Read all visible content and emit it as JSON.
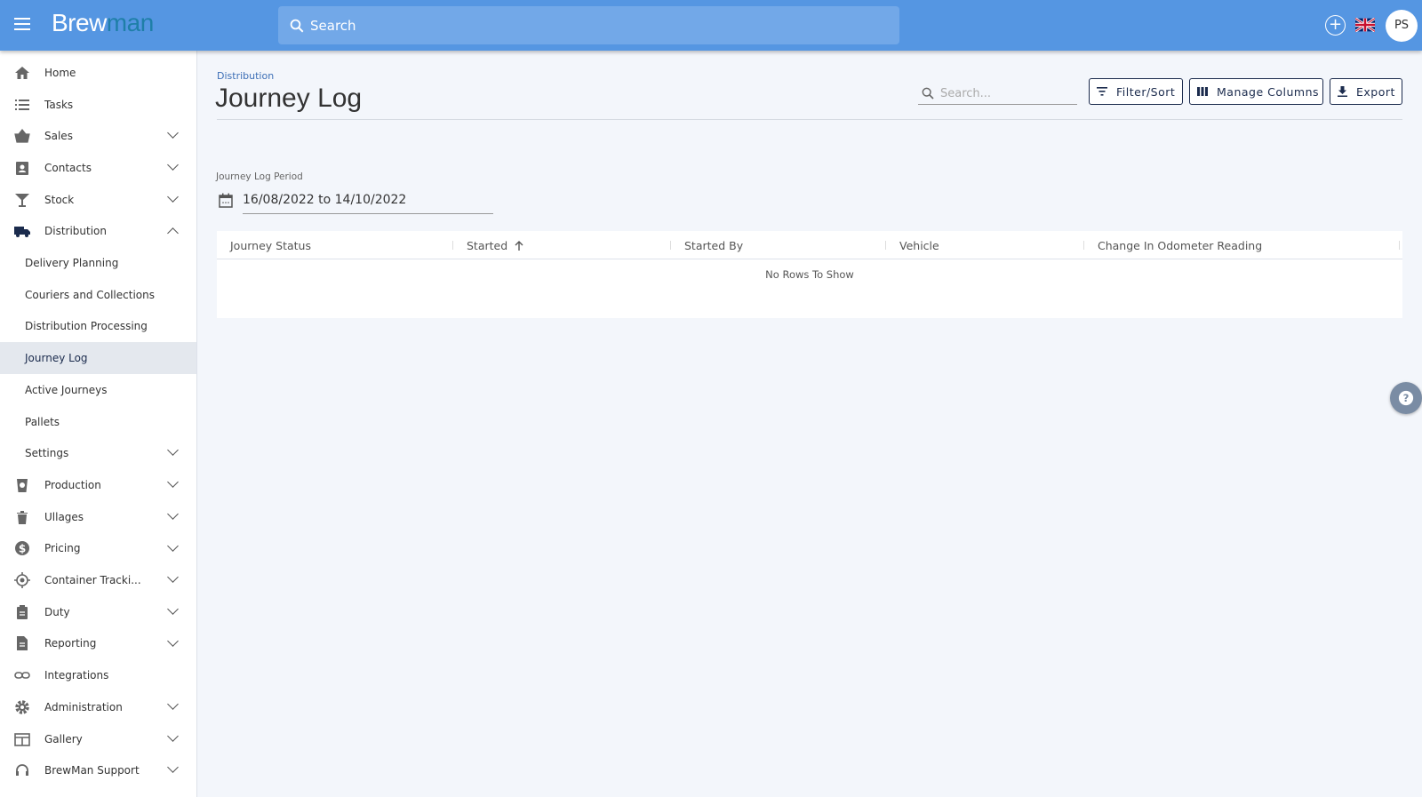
{
  "topbar": {
    "logo_a": "Brew",
    "logo_b": "man",
    "search_placeholder": "Search",
    "avatar_initials": "PS",
    "brand_color": "#5596e2"
  },
  "sidebar": {
    "items": [
      {
        "label": "Home",
        "icon": "home-icon",
        "chevron": "none"
      },
      {
        "label": "Tasks",
        "icon": "list-icon",
        "chevron": "none"
      },
      {
        "label": "Sales",
        "icon": "basket-icon",
        "chevron": "down"
      },
      {
        "label": "Contacts",
        "icon": "contacts-icon",
        "chevron": "down"
      },
      {
        "label": "Stock",
        "icon": "glass-icon",
        "chevron": "down"
      },
      {
        "label": "Distribution",
        "icon": "truck-icon",
        "chevron": "up"
      },
      {
        "label": "Delivery Planning",
        "sub": true
      },
      {
        "label": "Couriers and Collections",
        "sub": true
      },
      {
        "label": "Distribution Processing",
        "sub": true
      },
      {
        "label": "Journey Log",
        "sub": true,
        "active": true
      },
      {
        "label": "Active Journeys",
        "sub": true
      },
      {
        "label": "Pallets",
        "sub": true
      },
      {
        "label": "Settings",
        "sub": true,
        "chevron": "down"
      },
      {
        "label": "Production",
        "icon": "production-icon",
        "chevron": "down"
      },
      {
        "label": "Ullages",
        "icon": "trash-icon",
        "chevron": "down"
      },
      {
        "label": "Pricing",
        "icon": "dollar-icon",
        "chevron": "down"
      },
      {
        "label": "Container Tracki...",
        "icon": "target-icon",
        "chevron": "down"
      },
      {
        "label": "Duty",
        "icon": "clipboard-icon",
        "chevron": "down"
      },
      {
        "label": "Reporting",
        "icon": "document-icon",
        "chevron": "down"
      },
      {
        "label": "Integrations",
        "icon": "link-icon",
        "chevron": "none"
      },
      {
        "label": "Administration",
        "icon": "gear-icon",
        "chevron": "down"
      },
      {
        "label": "Gallery",
        "icon": "gallery-icon",
        "chevron": "down"
      },
      {
        "label": "BrewMan Support",
        "icon": "headset-icon",
        "chevron": "down"
      }
    ]
  },
  "main": {
    "breadcrumb": "Distribution",
    "title": "Journey Log",
    "search_placeholder": "Search...",
    "buttons": {
      "filter": "Filter/Sort",
      "columns": "Manage Columns",
      "export": "Export"
    },
    "period_label": "Journey Log Period",
    "period_value": "16/08/2022 to 14/10/2022",
    "columns": [
      "Journey Status",
      "Started",
      "Started By",
      "Vehicle",
      "Change In Odometer Reading"
    ],
    "sorted_column": "Started",
    "sort_direction": "ascending",
    "empty_text": "No Rows To Show"
  }
}
